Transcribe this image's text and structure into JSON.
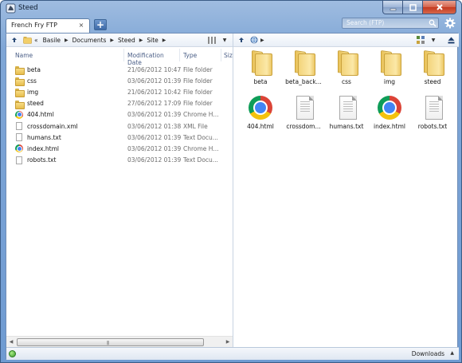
{
  "window": {
    "title": "Steed",
    "tab_label": "French Fry FTP",
    "tab_close": "×",
    "new_tab": "+",
    "search_placeholder": "Search (FTP)"
  },
  "left_toolbar": {
    "back_label": "«",
    "breadcrumb": [
      "Basile",
      "Documents",
      "Steed",
      "Site"
    ]
  },
  "columns": {
    "name": "Name",
    "date": "Modification Date",
    "type": "Type",
    "size": "Size"
  },
  "files": [
    {
      "name": "beta",
      "date": "21/06/2012 10:47",
      "type": "File folder",
      "icon": "folder-icon"
    },
    {
      "name": "css",
      "date": "03/06/2012 01:39",
      "type": "File folder",
      "icon": "folder-icon"
    },
    {
      "name": "img",
      "date": "21/06/2012 10:42",
      "type": "File folder",
      "icon": "folder-icon"
    },
    {
      "name": "steed",
      "date": "27/06/2012 17:09",
      "type": "File folder",
      "icon": "folder-icon"
    },
    {
      "name": "404.html",
      "date": "03/06/2012 01:39",
      "type": "Chrome H...",
      "icon": "chrome-icon"
    },
    {
      "name": "crossdomain.xml",
      "date": "03/06/2012 01:38",
      "type": "XML File",
      "icon": "document-icon"
    },
    {
      "name": "humans.txt",
      "date": "03/06/2012 01:39",
      "type": "Text Docu...",
      "icon": "document-icon"
    },
    {
      "name": "index.html",
      "date": "03/06/2012 01:39",
      "type": "Chrome H...",
      "icon": "chrome-icon"
    },
    {
      "name": "robots.txt",
      "date": "03/06/2012 01:39",
      "type": "Text Docu...",
      "icon": "document-icon"
    }
  ],
  "remote_items": [
    {
      "name": "beta",
      "icon": "folder-icon"
    },
    {
      "name": "beta_back...",
      "icon": "folder-icon"
    },
    {
      "name": "css",
      "icon": "folder-icon"
    },
    {
      "name": "img",
      "icon": "folder-icon"
    },
    {
      "name": "steed",
      "icon": "folder-icon"
    },
    {
      "name": "404.html",
      "icon": "chrome-icon"
    },
    {
      "name": "crossdom...",
      "icon": "document-icon"
    },
    {
      "name": "humans.txt",
      "icon": "document-icon"
    },
    {
      "name": "index.html",
      "icon": "chrome-icon"
    },
    {
      "name": "robots.txt",
      "icon": "document-icon"
    }
  ],
  "statusbar": {
    "downloads_label": "Downloads"
  },
  "colors": {
    "frame": "#7fa6d6",
    "header_text": "#4a5e86",
    "close_button": "#c4391f",
    "status_ok": "#3b9a2b"
  }
}
